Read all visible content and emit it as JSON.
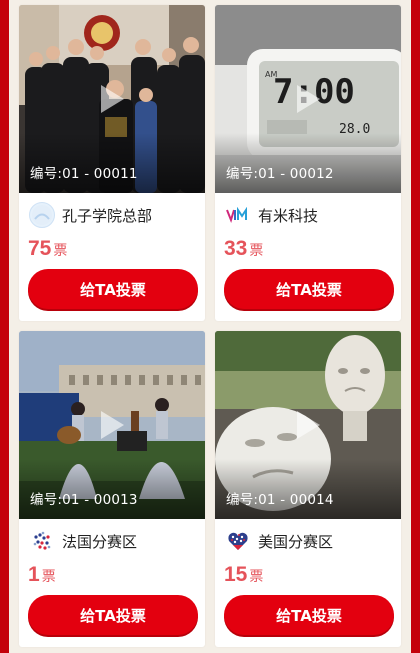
{
  "cards": [
    {
      "code": "编号:01 - 00011",
      "org": "孔子学院总部",
      "votes": "75",
      "vote_unit": "票",
      "button": "给TA投票",
      "logo_icon": "confucius-institute-logo"
    },
    {
      "code": "编号:01 - 00012",
      "org": "有米科技",
      "votes": "33",
      "vote_unit": "票",
      "button": "给TA投票",
      "logo_icon": "youmi-logo"
    },
    {
      "code": "编号:01 - 00013",
      "org": "法国分赛区",
      "votes": "1",
      "vote_unit": "票",
      "button": "给TA投票",
      "logo_icon": "france-division-logo"
    },
    {
      "code": "编号:01 - 00014",
      "org": "美国分赛区",
      "votes": "15",
      "vote_unit": "票",
      "button": "给TA投票",
      "logo_icon": "usa-division-logo"
    }
  ],
  "colors": {
    "frame": "#c4000b",
    "background": "#f4efe7",
    "button": "#e3000f",
    "vote_text": "#e5535a"
  }
}
